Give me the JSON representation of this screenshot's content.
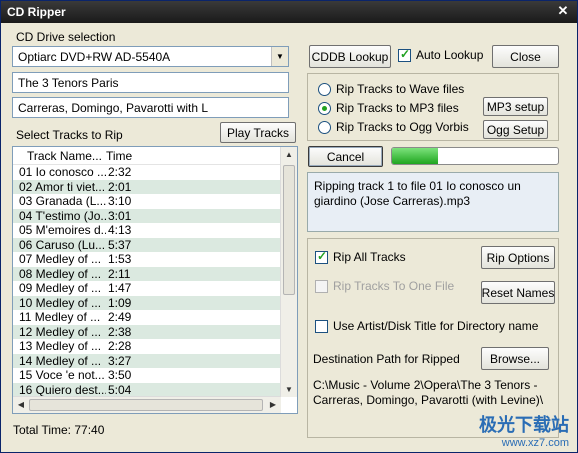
{
  "window": {
    "title": "CD Ripper",
    "close_glyph": "✕"
  },
  "drive": {
    "label": "CD Drive selection",
    "selected": "Optiarc  DVD+RW AD-5540A"
  },
  "album_title": "The 3 Tenors Paris",
  "artist": "Carreras, Domingo, Pavarotti with L",
  "buttons": {
    "cddb_lookup": "CDDB Lookup",
    "close": "Close",
    "play_tracks": "Play Tracks",
    "mp3_setup": "MP3 setup",
    "ogg_setup": "Ogg Setup",
    "cancel": "Cancel",
    "rip_options": "Rip Options",
    "reset_names": "Reset Names",
    "browse": "Browse..."
  },
  "auto_lookup": {
    "label": "Auto Lookup",
    "checked": true
  },
  "rip_formats": {
    "options": [
      "Rip Tracks to Wave files",
      "Rip Tracks to MP3 files",
      "Rip Tracks to Ogg Vorbis"
    ],
    "selected_index": 1
  },
  "tracks": {
    "label": "Select Tracks to Rip",
    "columns": [
      "Track Name...",
      "Time"
    ],
    "rows": [
      [
        "01 Io conosco ...",
        "2:32"
      ],
      [
        "02 Amor ti viet...",
        "2:01"
      ],
      [
        "03 Granada (L...",
        "3:10"
      ],
      [
        "04 T'estimo (Jo...",
        "3:01"
      ],
      [
        "05 M'emoires d...",
        "4:13"
      ],
      [
        "06 Caruso (Lu...",
        "5:37"
      ],
      [
        "07 Medley of ...",
        "1:53"
      ],
      [
        "08 Medley of ...",
        "2:11"
      ],
      [
        "09 Medley of ...",
        "1:47"
      ],
      [
        "10 Medley of ...",
        "1:09"
      ],
      [
        "11 Medley of ...",
        "2:49"
      ],
      [
        "12 Medley of ...",
        "2:38"
      ],
      [
        "13 Medley of ...",
        "2:28"
      ],
      [
        "14 Medley of ...",
        "3:27"
      ],
      [
        "15 Voce 'e not...",
        "3:50"
      ],
      [
        "16 Quiero dest...",
        "5:04"
      ]
    ]
  },
  "total_time": "Total Time: 77:40",
  "progress": {
    "fraction": 0.28
  },
  "status": "Ripping track 1 to file 01 Io conosco un giardino (Jose Carreras).mp3",
  "options": {
    "rip_all_tracks": {
      "label": "Rip All Tracks",
      "checked": true
    },
    "rip_to_one_file": {
      "label": "Rip Tracks To One File",
      "checked": false,
      "disabled": true
    },
    "use_artist_title": {
      "label": "Use Artist/Disk Title for Directory name",
      "checked": false
    }
  },
  "destination": {
    "label": "Destination Path for Ripped",
    "path": "C:\\Music - Volume 2\\Opera\\The 3 Tenors - Carreras, Domingo, Pavarotti (with Levine)\\"
  },
  "watermark": {
    "line1": "极光下载站",
    "line2": "www.xz7.com"
  }
}
